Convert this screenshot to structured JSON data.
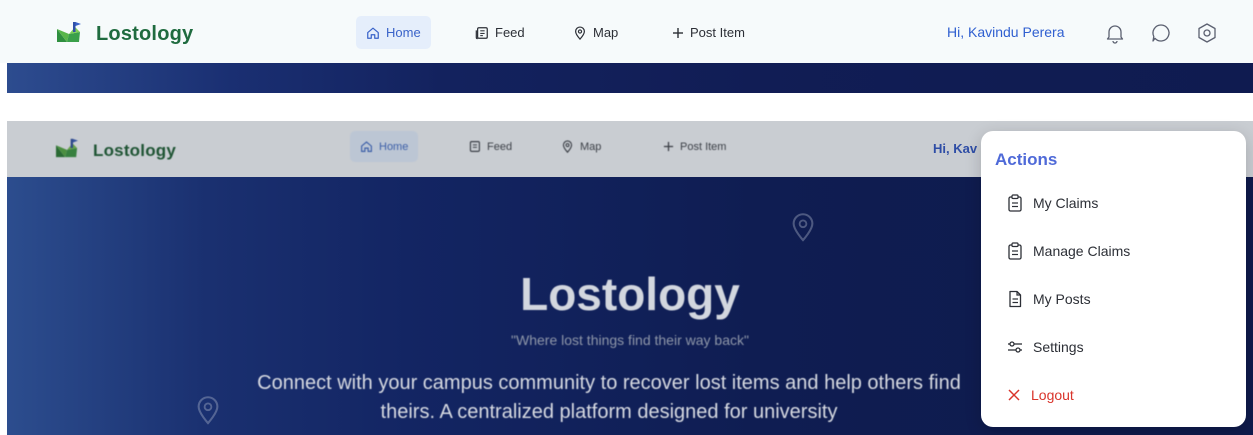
{
  "brand": {
    "name": "Lostology",
    "logo_icon": "lostology-logo-icon"
  },
  "nav": {
    "home": "Home",
    "feed": "Feed",
    "map": "Map",
    "post_item": "Post Item"
  },
  "user": {
    "greeting": "Hi, Kavindu Perera",
    "greeting_truncated": "Hi, Kav"
  },
  "top_icons": [
    "bell-icon",
    "chat-icon",
    "settings-hex-icon"
  ],
  "hero": {
    "title": "Lostology",
    "tagline": "\"Where lost things find their way back\"",
    "description": "Connect with your campus community to recover lost items and help others find theirs. A centralized platform designed for university"
  },
  "dropdown": {
    "title": "Actions",
    "items": [
      {
        "label": "My Claims",
        "icon": "clipboard-icon"
      },
      {
        "label": "Manage Claims",
        "icon": "clipboard-icon"
      },
      {
        "label": "My Posts",
        "icon": "document-icon"
      },
      {
        "label": "Settings",
        "icon": "sliders-icon"
      },
      {
        "label": "Logout",
        "icon": "x-icon"
      }
    ]
  },
  "colors": {
    "brand_green": "#1f6b3f",
    "accent_blue": "#3a63c9",
    "hero_navy": "#111d55",
    "logout_red": "#d9342b"
  }
}
